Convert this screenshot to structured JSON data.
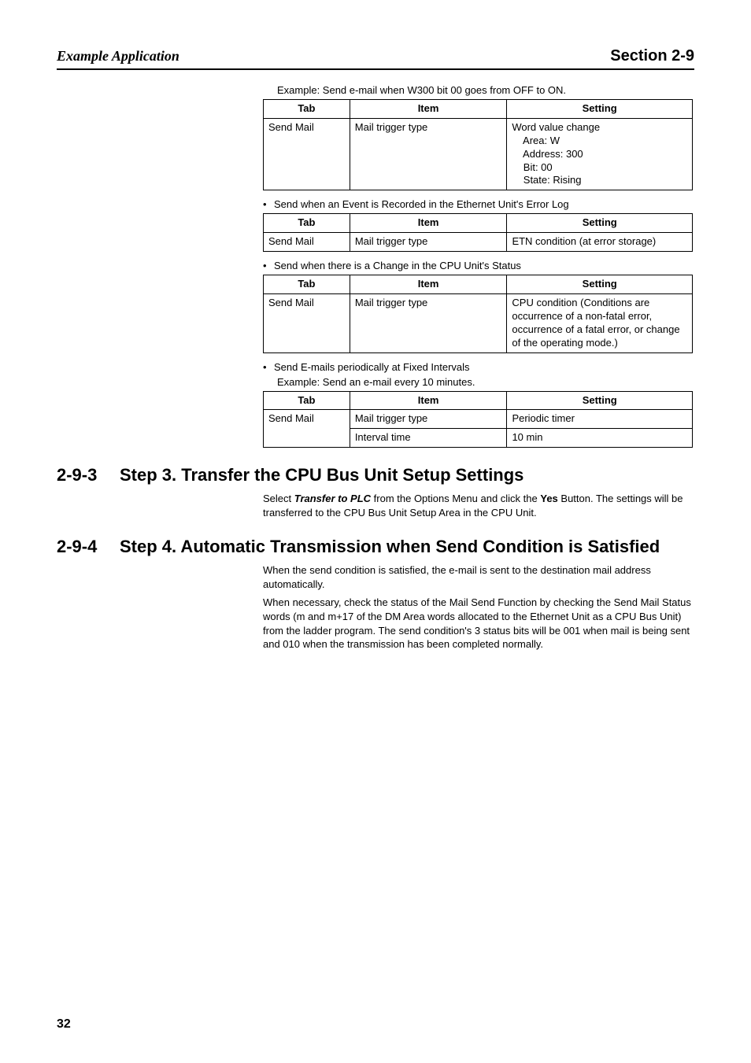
{
  "header": {
    "left": "Example Application",
    "right": "Section 2-9"
  },
  "intro_line": "Example: Send e-mail when W300 bit 00 goes from OFF to ON.",
  "table_headers": {
    "tab": "Tab",
    "item": "Item",
    "setting": "Setting"
  },
  "table1": {
    "tab": "Send Mail",
    "item": "Mail trigger type",
    "setting": "Word value change\n    Area: W\n    Address: 300\n    Bit: 00\n    State: Rising"
  },
  "bullet_error_log": "Send when an Event is Recorded in the Ethernet Unit's Error Log",
  "table2": {
    "tab": "Send Mail",
    "item": "Mail trigger type",
    "setting": "ETN condition (at error storage)"
  },
  "bullet_cpu_status": "Send when there is a Change in the CPU Unit's Status",
  "table3": {
    "tab": "Send Mail",
    "item": "Mail trigger type",
    "setting": "CPU condition\n(Conditions are occurrence of a non-fatal error, occurrence of a fatal error, or change of the operating mode.)"
  },
  "bullet_periodic": "Send E-mails periodically at Fixed Intervals",
  "periodic_example": "Example: Send an e-mail every 10 minutes.",
  "table4": {
    "tab": "Send Mail",
    "row1_item": "Mail trigger type",
    "row1_setting": "Periodic timer",
    "row2_item": "Interval time",
    "row2_setting": "10 min"
  },
  "sec293": {
    "num": "2-9-3",
    "title": "Step 3. Transfer the CPU Bus Unit Setup Settings",
    "para_pre": "Select ",
    "para_bi": "Transfer to PLC",
    "para_mid": " from the Options Menu and click the ",
    "para_b": "Yes",
    "para_post": " Button. The settings will be transferred to the CPU Bus Unit Setup Area in the CPU Unit."
  },
  "sec294": {
    "num": "2-9-4",
    "title": "Step 4. Automatic Transmission when Send Condition is Satisfied",
    "p1": "When the send condition is satisfied, the e-mail is sent to the destination mail address automatically.",
    "p2": "When necessary, check the status of the Mail Send Function by checking the Send Mail Status words (m and m+17 of the DM Area words allocated to the Ethernet Unit as a CPU Bus Unit) from the ladder program. The send condition's 3 status bits will be 001 when mail is being sent and 010 when the transmission has been completed normally."
  },
  "page_number": "32"
}
